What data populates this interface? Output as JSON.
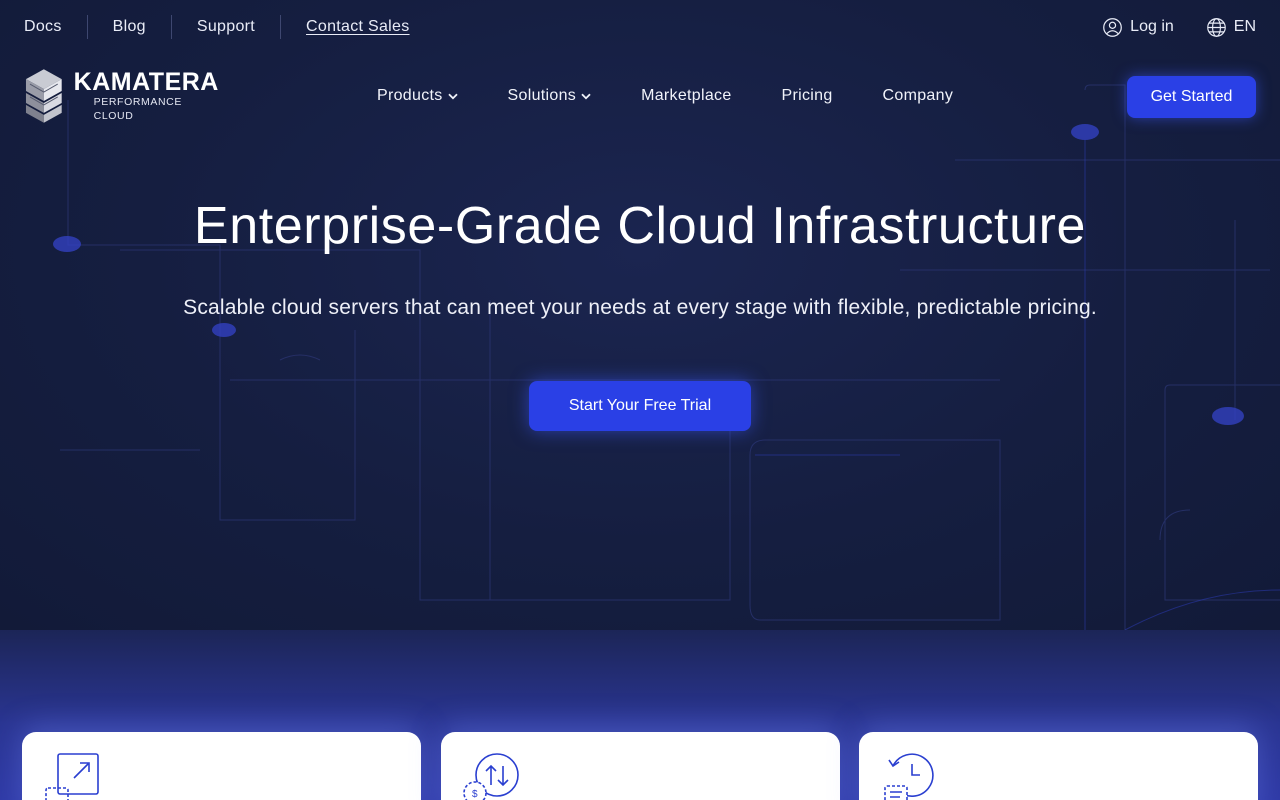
{
  "utility_nav": {
    "links": [
      "Docs",
      "Blog",
      "Support",
      "Contact Sales"
    ],
    "login": "Log in",
    "language": "EN"
  },
  "logo": {
    "name": "KAMATERA",
    "tagline": "PERFORMANCE CLOUD"
  },
  "main_nav": {
    "items": [
      "Products",
      "Solutions",
      "Marketplace",
      "Pricing",
      "Company"
    ],
    "cta": "Get Started"
  },
  "hero": {
    "title": "Enterprise-Grade Cloud Infrastructure",
    "subtitle": "Scalable cloud servers that can meet your needs at every stage with flexible, predictable pricing.",
    "cta": "Start Your Free Trial"
  },
  "feature_cards": [
    {
      "icon": "scale-arrows-icon"
    },
    {
      "icon": "cost-transfer-icon"
    },
    {
      "icon": "clock-document-icon"
    }
  ],
  "colors": {
    "background": "#141d3c",
    "accent": "#2a40e6",
    "lower_band": "#2f3aa6"
  }
}
